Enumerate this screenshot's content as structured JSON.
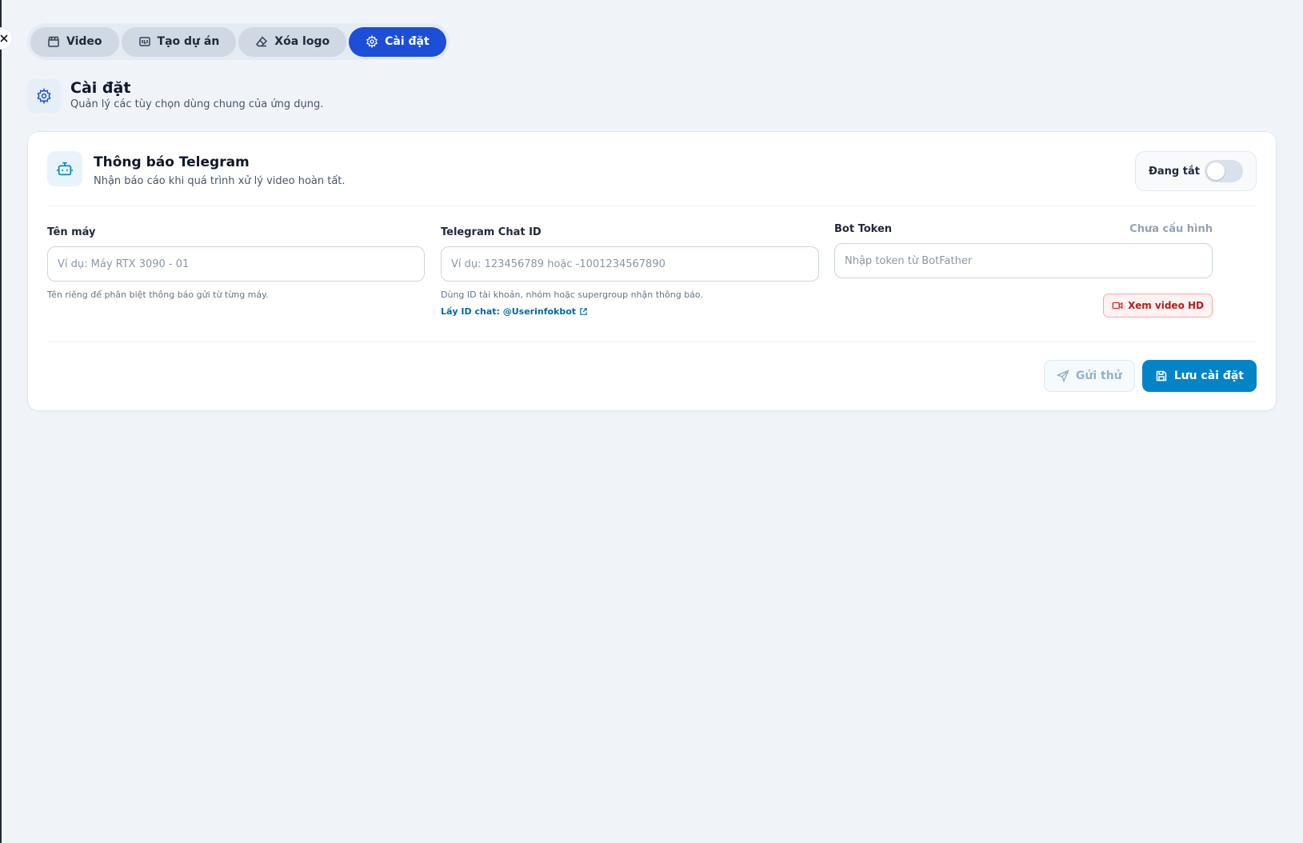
{
  "tabs": [
    {
      "label": "Video",
      "icon": "clapperboard-icon",
      "active": false
    },
    {
      "label": "Tạo dự án",
      "icon": "project-icon",
      "active": false
    },
    {
      "label": "Xóa logo",
      "icon": "eraser-icon",
      "active": false
    },
    {
      "label": "Cài đặt",
      "icon": "gear-icon",
      "active": true
    }
  ],
  "page": {
    "title": "Cài đặt",
    "subtitle": "Quản lý các tùy chọn dùng chung của ứng dụng.",
    "icon": "gear-icon"
  },
  "telegram": {
    "title": "Thông báo Telegram",
    "subtitle": "Nhận báo cáo khi quá trình xử lý video hoàn tất.",
    "icon": "bot-icon",
    "toggle_label": "Đang tắt",
    "enabled": false,
    "fields": {
      "machine_name": {
        "label": "Tên máy",
        "placeholder": "Ví dụ: Máy RTX 3090 - 01",
        "value": "",
        "hint": "Tên riêng để phân biệt thông báo gửi từ từng máy."
      },
      "chat_id": {
        "label": "Telegram Chat ID",
        "placeholder": "Ví dụ: 123456789 hoặc -1001234567890",
        "value": "",
        "hint": "Dùng ID tài khoản, nhóm hoặc supergroup nhận thông báo.",
        "link": "Lấy ID chat: @Userinfokbot"
      },
      "bot_token": {
        "label": "Bot Token",
        "status": "Chưa cấu hình",
        "placeholder": "Nhập token từ BotFather",
        "value": "",
        "video_button": "Xem video HD"
      }
    },
    "actions": {
      "test_label": "Gửi thử",
      "save_label": "Lưu cài đặt"
    }
  },
  "colors": {
    "accent": "#1d4ed8",
    "primary_button": "#0284c7",
    "danger": "#b91c1c",
    "background": "#f0f4f9"
  }
}
